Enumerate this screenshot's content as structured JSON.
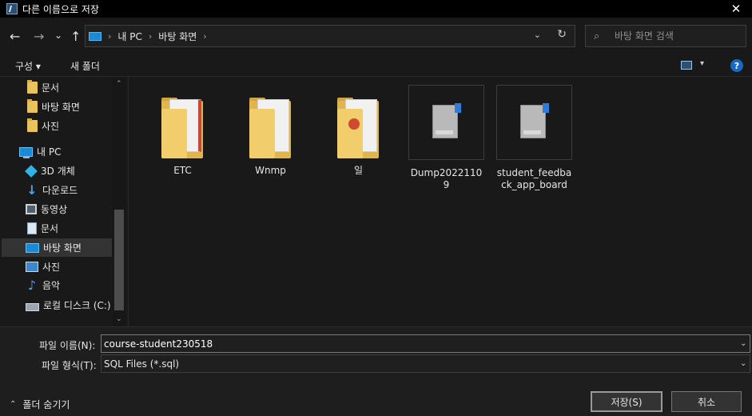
{
  "window": {
    "title": "다른 이름으로 저장",
    "close_glyph": "✕"
  },
  "nav": {
    "back_glyph": "←",
    "forward_glyph": "→",
    "recent_glyph": "⌄",
    "up_glyph": "↑",
    "breadcrumbs": [
      "내 PC",
      "바탕 화면"
    ],
    "sep_glyph": "›",
    "dropdown_glyph": "⌄",
    "refresh_glyph": "↻",
    "search_placeholder": "바탕 화면 검색",
    "search_glyph": "⌕"
  },
  "toolbar": {
    "organize_label": "구성 ▾",
    "new_folder_label": "새 폴더",
    "help_label": "?"
  },
  "sidebar": {
    "items": [
      {
        "label": "문서",
        "icon": "folder-icon"
      },
      {
        "label": "바탕 화면",
        "icon": "folder-icon"
      },
      {
        "label": "사진",
        "icon": "folder-icon"
      },
      {
        "label": "내 PC",
        "icon": "pc-icon"
      },
      {
        "label": "3D 개체",
        "icon": "cube-icon"
      },
      {
        "label": "다운로드",
        "icon": "download-icon"
      },
      {
        "label": "동영상",
        "icon": "video-icon"
      },
      {
        "label": "문서",
        "icon": "document-icon"
      },
      {
        "label": "바탕 화면",
        "icon": "desktop-icon"
      },
      {
        "label": "사진",
        "icon": "picture-icon"
      },
      {
        "label": "음악",
        "icon": "music-icon"
      },
      {
        "label": "로컬 디스크 (C:)",
        "icon": "drive-icon"
      }
    ],
    "selected_index": 8
  },
  "files": [
    {
      "name": "ETC",
      "type": "folder"
    },
    {
      "name": "Wnmp",
      "type": "folder"
    },
    {
      "name": "일",
      "type": "folder"
    },
    {
      "name": "Dump20221109",
      "type": "sql"
    },
    {
      "name": "student_feedback_app_board",
      "type": "sql"
    }
  ],
  "form": {
    "filename_label": "파일 이름(N):",
    "filename_value": "course-student230518",
    "filetype_label": "파일 형식(T):",
    "filetype_value": "SQL Files (*.sql)"
  },
  "footer": {
    "hide_folders_label": "폴더 숨기기",
    "hide_glyph": "⌃",
    "save_label": "저장(S)",
    "cancel_label": "취소"
  }
}
